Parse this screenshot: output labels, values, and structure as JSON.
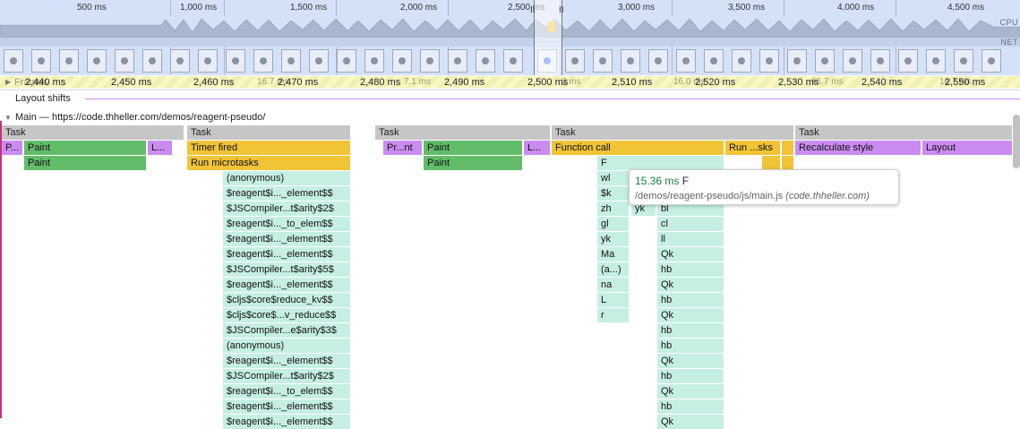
{
  "overview": {
    "ticks": [
      "500 ms",
      "1,000 ms",
      "1,500 ms",
      "2,000 ms",
      "2,500 ms",
      "3,000 ms",
      "3,500 ms",
      "4,000 ms",
      "4,500 ms"
    ],
    "cpu_label": "CPU",
    "net_label": "NET",
    "handle_left": "II",
    "handle_right": "II"
  },
  "ruler": {
    "ticks": [
      "2,440 ms",
      "2,450 ms",
      "2,460 ms",
      "2,470 ms",
      "2,480 ms",
      "2,490 ms",
      "2,500 ms",
      "2,510 ms",
      "2,520 ms",
      "2,530 ms",
      "2,540 ms",
      "2,550 ms"
    ],
    "frame_times": [
      "16.7 ms",
      "7.1 ms",
      "3 ms",
      "16.0 ms",
      "16.7 ms",
      "16.7 ms"
    ]
  },
  "tracks": {
    "frames_label": "Frames",
    "layout_shifts_label": "Layout shifts",
    "main_label": "Main — https://code.thheller.com/demos/reagent-pseudo/"
  },
  "flame": {
    "task": "Task",
    "paint": "Paint",
    "p_short": "P...",
    "l_short": "L...",
    "print_short": "Pr...nt",
    "timer_fired": "Timer fired",
    "run_microtasks": "Run microtasks",
    "function_call": "Function call",
    "run_sks": "Run ...sks",
    "recalculate_style": "Recalculate style",
    "layout": "Layout",
    "stack1": [
      "(anonymous)",
      "$reagent$i..._element$$",
      "$JSCompiler...t$arity$2$",
      "$reagent$i..._to_elem$$",
      "$reagent$i..._element$$",
      "$reagent$i..._element$$",
      "$JSCompiler...t$arity$5$",
      "$reagent$i..._element$$",
      "$cljs$core$reduce_kv$$",
      "$cljs$core$...v_reduce$$",
      "$JSCompiler...e$arity$3$",
      "(anonymous)",
      "$reagent$i..._element$$",
      "$JSCompiler...t$arity$2$",
      "$reagent$i..._to_elem$$",
      "$reagent$i..._element$$",
      "$reagent$i..._element$$"
    ],
    "stack2_f": "F",
    "stack2_left": [
      "wl",
      "$k",
      "zh",
      "gl",
      "yk",
      "Ma",
      "(a...)",
      "na",
      "L",
      "r"
    ],
    "stack2_yk": "yk",
    "stack2_right": [
      "bl",
      "cl",
      "ll",
      "Qk",
      "hb",
      "Qk",
      "hb",
      "Qk",
      "hb",
      "hb",
      "Qk",
      "hb",
      "Qk",
      "hb",
      "Qk",
      "hb"
    ]
  },
  "tooltip": {
    "duration": "15.36 ms",
    "name": "F",
    "path": "/demos/reagent-pseudo/js/main.js",
    "origin": "(code.thheller.com)"
  }
}
